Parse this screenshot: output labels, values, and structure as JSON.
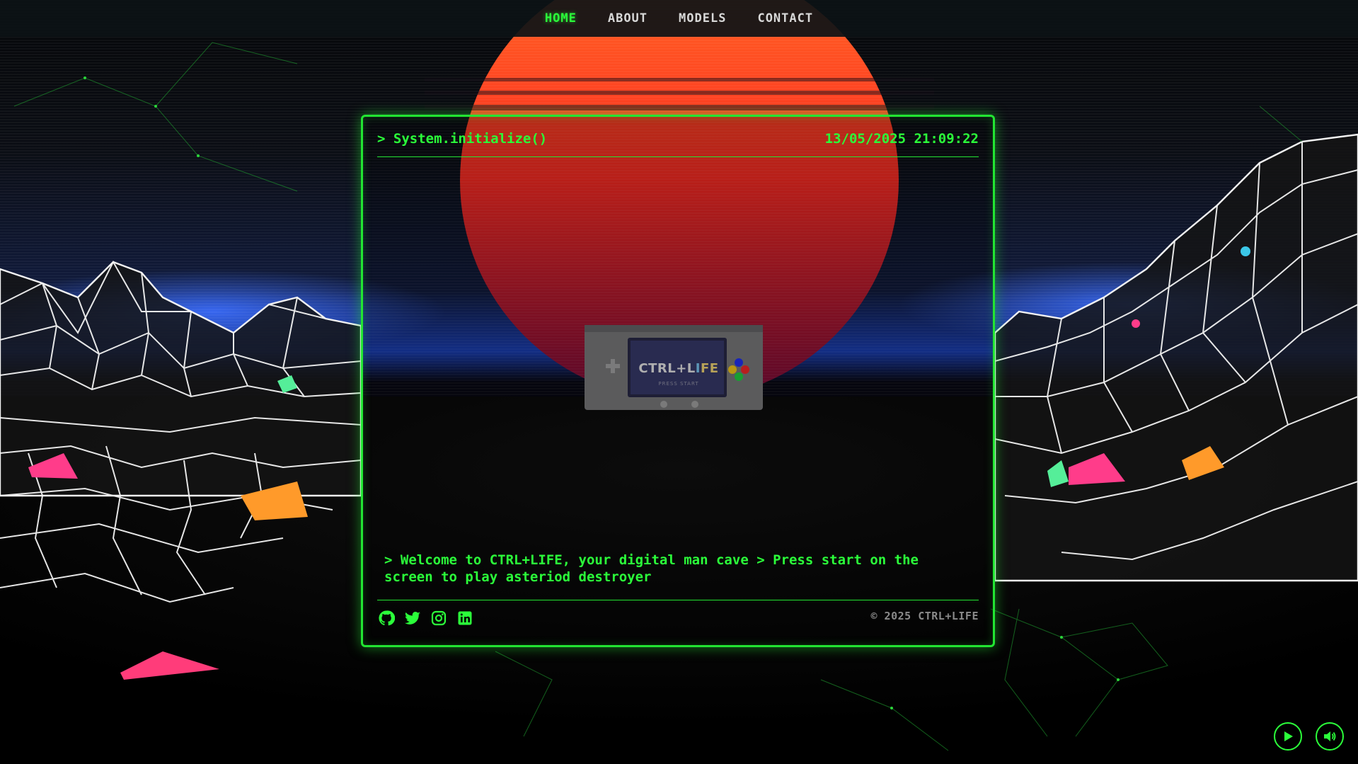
{
  "nav": {
    "items": [
      {
        "label": "HOME",
        "active": true
      },
      {
        "label": "ABOUT",
        "active": false
      },
      {
        "label": "MODELS",
        "active": false
      },
      {
        "label": "CONTACT",
        "active": false
      }
    ]
  },
  "terminal": {
    "command": "> System.initialize()",
    "datetime": "13/05/2025 21:09:22",
    "message": "> Welcome to CTRL+LIFE, your digital man cave > Press start on the screen to play asteriod destroyer",
    "copyright": "© 2025 CTRL+LIFE",
    "socials": [
      {
        "icon": "github-icon"
      },
      {
        "icon": "twitter-icon"
      },
      {
        "icon": "instagram-icon"
      },
      {
        "icon": "linkedin-icon"
      }
    ]
  },
  "console": {
    "logo_ctrl": "CTRL+L",
    "logo_i": "I",
    "logo_fe": "FE",
    "sub_label": "PRESS START"
  },
  "controls": {
    "play_icon": "play-icon",
    "sound_icon": "volume-icon"
  },
  "colors": {
    "accent": "#2bff3a",
    "sun_top": "#ff5a1e",
    "sun_bottom": "#ff1a2a",
    "horizon": "#2a5cff"
  }
}
